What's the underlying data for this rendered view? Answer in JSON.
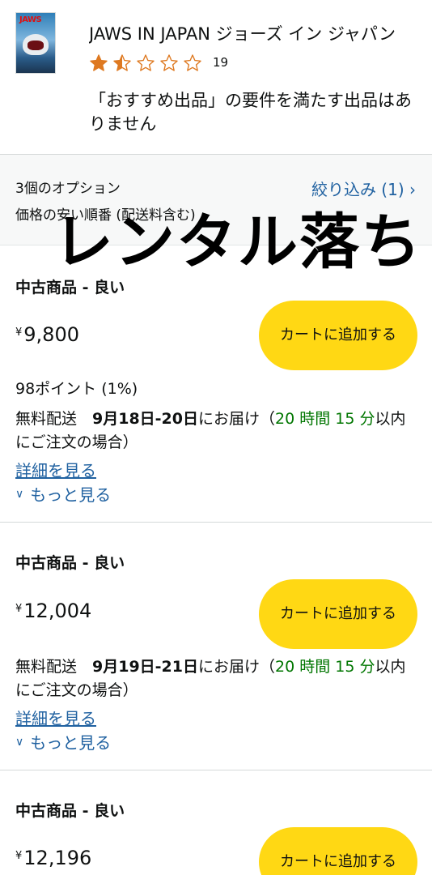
{
  "product": {
    "title": "JAWS IN JAPAN ジョーズ イン ジャパン",
    "rating_count": "19",
    "rating_value": 1.5,
    "rating_max": 5,
    "no_featured_offer": "「おすすめ出品」の要件を満たす出品はありません",
    "thumbnail_logo": "JAWS"
  },
  "filter_bar": {
    "option_count": "3個のオプション",
    "sort_order": "価格の安い順番 (配送料含む)",
    "filter_link": "絞り込み (1) ›"
  },
  "overlay": {
    "text": "レンタル落ち"
  },
  "offers": [
    {
      "condition": "中古商品 - 良い",
      "currency": "¥",
      "price": "9,800",
      "points": "98ポイント (1%)",
      "delivery_prefix": "無料配送　",
      "delivery_date": "9月18日-20日",
      "delivery_mid": "にお届け（",
      "delivery_countdown": "20 時間 15 分",
      "delivery_suffix": "以内にご注文の場合）",
      "details_link": "詳細を見る",
      "see_more": "もっと見る",
      "add_to_cart": "カートに追加する"
    },
    {
      "condition": "中古商品 - 良い",
      "currency": "¥",
      "price": "12,004",
      "delivery_prefix": "無料配送　",
      "delivery_date": "9月19日-21日",
      "delivery_mid": "にお届け（",
      "delivery_countdown": "20 時間 15 分",
      "delivery_suffix": "以内にご注文の場合）",
      "details_link": "詳細を見る",
      "see_more": "もっと見る",
      "add_to_cart": "カートに追加する"
    },
    {
      "condition": "中古商品 - 良い",
      "currency": "¥",
      "price": "12,196",
      "add_to_cart": "カートに追加する"
    }
  ],
  "colors": {
    "cart_button": "#ffd814",
    "link": "#2162a1",
    "star": "#de7921",
    "countdown": "#007600"
  }
}
